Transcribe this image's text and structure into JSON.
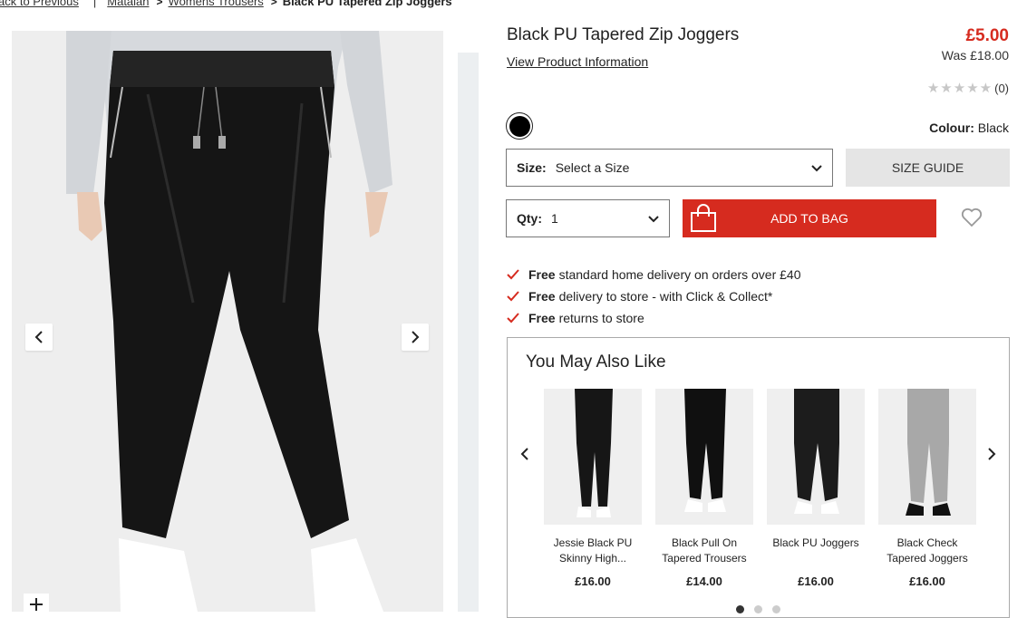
{
  "breadcrumb": {
    "back": "ack to Previous",
    "items": [
      "Matalan",
      "Womens Trousers"
    ],
    "current": "Black PU Tapered Zip Joggers"
  },
  "product": {
    "title": "Black PU Tapered Zip Joggers",
    "view_info": "View Product Information",
    "price": "£5.00",
    "was_price": "Was £18.00",
    "rating_count": "(0)",
    "rating_value": 0,
    "colour_label": "Colour:",
    "colour_value": "Black",
    "swatch_color": "#000000"
  },
  "size": {
    "label": "Size:",
    "value": "Select a Size"
  },
  "qty": {
    "label": "Qty:",
    "value": "1"
  },
  "size_guide": "SIZE GUIDE",
  "add_to_bag": "ADD TO BAG",
  "benefits": [
    {
      "bold": "Free",
      "text": "standard home delivery on orders over £40"
    },
    {
      "bold": "Free",
      "text": "delivery to store - with Click & Collect*"
    },
    {
      "bold": "Free",
      "text": "returns to store"
    }
  ],
  "recommendations": {
    "title": "You May Also Like",
    "items": [
      {
        "name": "Jessie Black PU Skinny High...",
        "price": "£16.00"
      },
      {
        "name": "Black Pull On Tapered Trousers",
        "price": "£14.00"
      },
      {
        "name": "Black PU Joggers",
        "price": "£16.00"
      },
      {
        "name": "Black Check Tapered Joggers",
        "price": "£16.00"
      }
    ],
    "page_count": 3,
    "active_page": 1
  },
  "colors": {
    "accent": "#d62b1f",
    "tick": "#d62b1f",
    "size_guide_bg": "#e5e5e5"
  }
}
